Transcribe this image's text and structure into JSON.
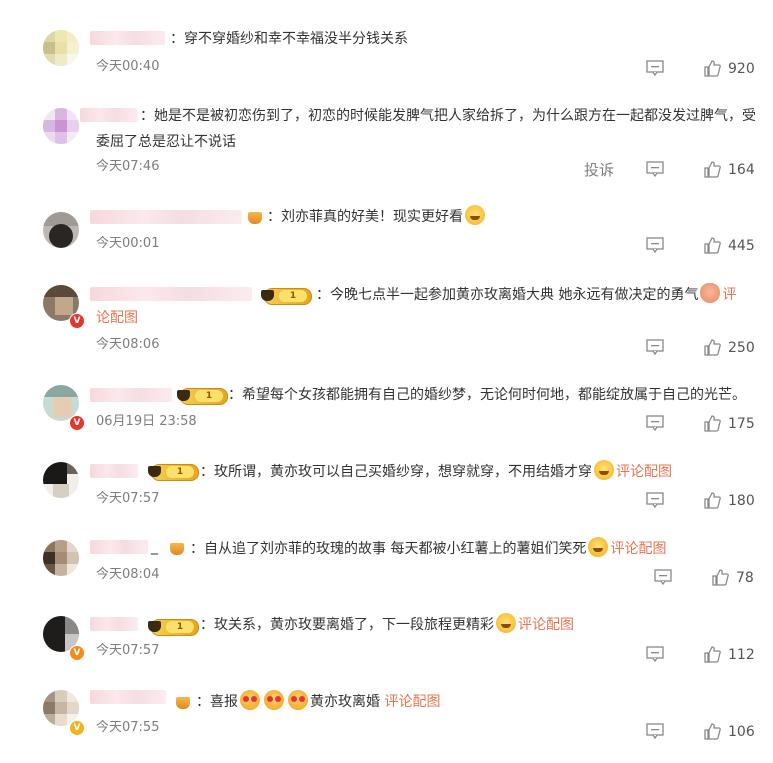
{
  "comments": [
    {
      "sep": "：",
      "text": "穿不穿婚纱和幸不幸福没半分钱关系",
      "time": "今天00:40",
      "likes": "920"
    },
    {
      "sep": "：",
      "text": "她是不是被初恋伤到了，初恋的时候能发脾气把人家给拆了，为什么跟方在一起都没发过脾气，受委屈了总是忍让不说话",
      "time": "今天07:46",
      "report": "投诉",
      "likes": "164"
    },
    {
      "sep": "：",
      "text": "刘亦菲真的好美！现实更好看",
      "time": "今天00:01",
      "likes": "445"
    },
    {
      "sep": "：",
      "text": "今晚七点半一起参加黄亦玫离婚大典 她永远有做决定的勇气",
      "link_a": "评",
      "link_b": "论配图",
      "time": "今天08:06",
      "likes": "250",
      "level": "1"
    },
    {
      "sep": "：",
      "text": "希望每个女孩都能拥有自己的婚纱梦，无论何时何地，都能绽放属于自己的光芒。",
      "time": "06月19日 23:58",
      "likes": "175",
      "level": "1"
    },
    {
      "sep": "：",
      "text": "玫所谓，黄亦玫可以自己买婚纱穿，想穿就穿，不用结婚才穿",
      "link": "评论配图",
      "time": "今天07:57",
      "likes": "180",
      "level": "1"
    },
    {
      "name_suffix": "_",
      "sep": "：",
      "text": "自从追了刘亦菲的玫瑰的故事 每天都被小红薯上的薯姐们笑死",
      "link": "评论配图",
      "time": "今天08:04",
      "likes": "78"
    },
    {
      "sep": "：",
      "text": "玫关系，黄亦玫要离婚了，下一段旅程更精彩",
      "link": "评论配图",
      "time": "今天07:57",
      "likes": "112",
      "level": "1"
    },
    {
      "sep": "：",
      "text_a": "喜报",
      "text_b": "黄亦玫离婚",
      "link": "评论配图",
      "time": "今天07:55",
      "likes": "106"
    }
  ],
  "icons": {
    "reply": "comment-bubble-icon",
    "like": "thumbs-up-icon",
    "crown": "crown-icon",
    "verified": "verified-v-icon"
  },
  "colors": {
    "link": "#eb7350",
    "verified_red": "#e3362e",
    "verified_orange": "#f28a1c",
    "verified_gold": "#f2b21c"
  }
}
